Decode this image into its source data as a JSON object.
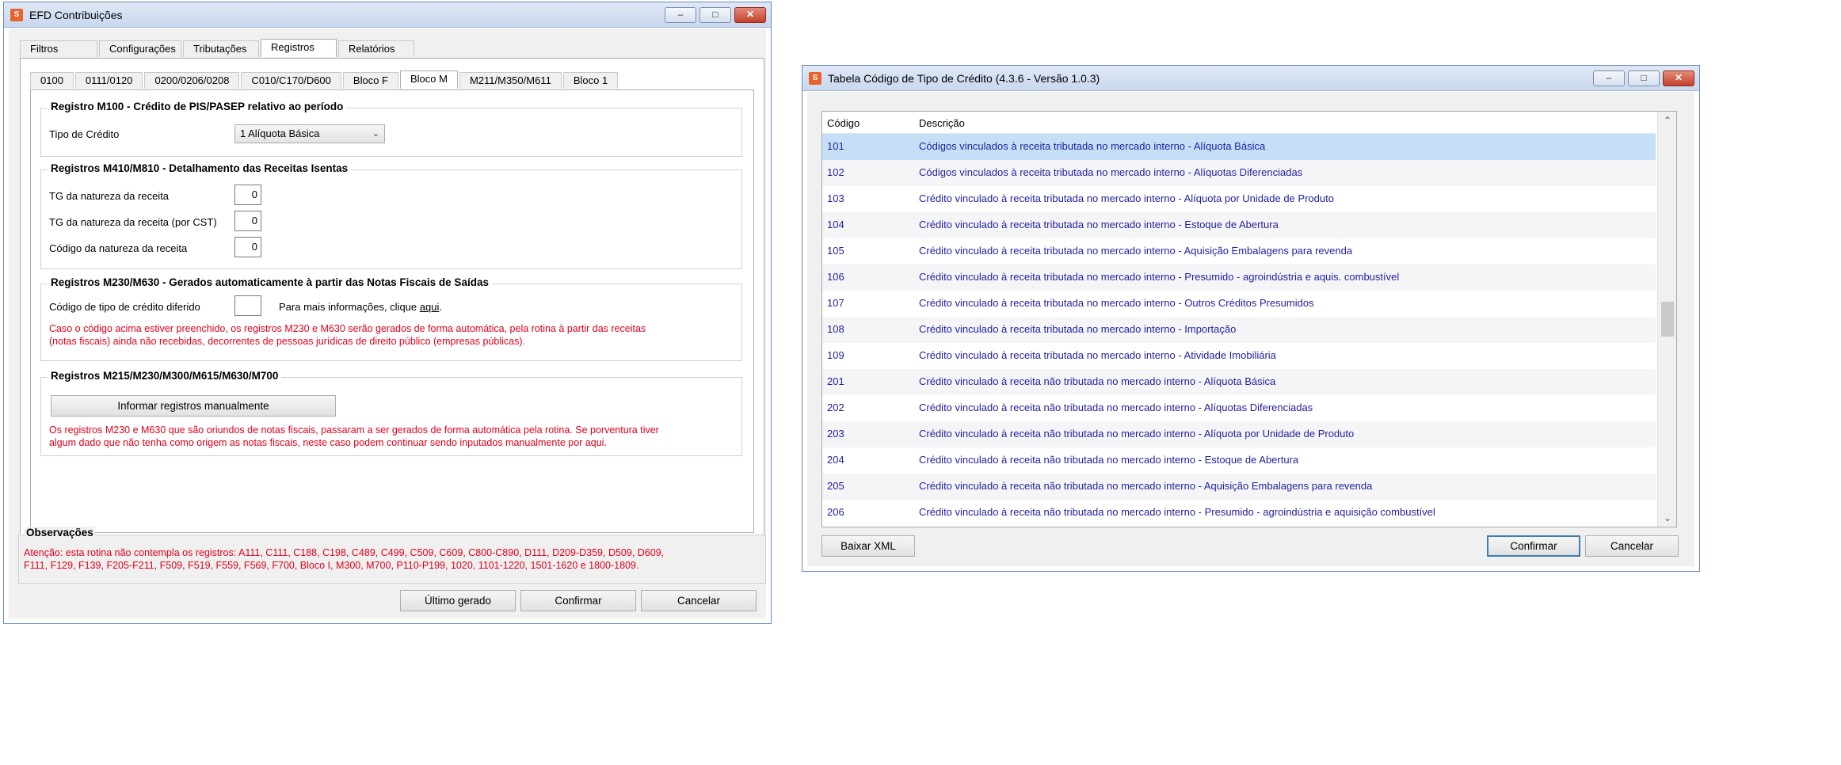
{
  "left_window": {
    "title": "EFD Contribuições",
    "top_tabs": [
      "Filtros",
      "Configurações",
      "Tributações",
      "Registros",
      "Relatórios"
    ],
    "sub_tabs": [
      "0100",
      "0111/0120",
      "0200/0206/0208",
      "C010/C170/D600",
      "Bloco F",
      "Bloco M",
      "M211/M350/M611",
      "Bloco 1"
    ],
    "m100": {
      "title": "Registro M100 - Crédito de PIS/PASEP relativo ao período",
      "tipo_label": "Tipo de Crédito",
      "tipo_value": "1 Alíquota Básica"
    },
    "m410": {
      "title": "Registros M410/M810 - Detalhamento das Receitas Isentas",
      "fields": [
        {
          "label": "TG da natureza da receita",
          "value": "0"
        },
        {
          "label": "TG da natureza da receita (por CST)",
          "value": "0"
        },
        {
          "label": "Código da natureza da receita",
          "value": "0"
        }
      ]
    },
    "m230": {
      "title": "Registros M230/M630 - Gerados automaticamente à partir das Notas Fiscais de Saídas",
      "codigo_label": "Código de tipo de crédito diferido",
      "info_prefix": "Para mais informações, clique ",
      "info_link": "aqui",
      "info_suffix": ".",
      "warning_line1": "Caso o código acima estiver preenchido, os registros M230 e M630 serão gerados de forma automática, pela rotina à partir das receitas",
      "warning_line2": "(notas fiscais) ainda não recebidas, decorrentes de pessoas jurídicas de direito público (empresas públicas)."
    },
    "m215": {
      "title": "Registros M215/M230/M300/M615/M630/M700",
      "button": "Informar registros manualmente",
      "warning_line1": "Os registros M230 e M630 que são oriundos de notas fiscais, passaram a ser gerados de forma automática pela rotina. Se porventura tiver",
      "warning_line2": "algum dado que não tenha como origem as notas fiscais, neste caso podem continuar sendo inputados manualmente por aqui."
    },
    "observacoes": {
      "title": "Observações",
      "line1": "Atenção: esta rotina não contempla os registros: A111, C111, C188, C198, C489, C499, C509, C609, C800-C890, D111, D209-D359, D509, D609,",
      "line2": "F111, F129, F139, F205-F211, F509, F519, F559, F569, F700, Bloco I, M300, M700, P110-P199, 1020, 1101-1220, 1501-1620 e 1800-1809."
    },
    "buttons": {
      "ultimo": "Último gerado",
      "confirmar": "Confirmar",
      "cancelar": "Cancelar"
    }
  },
  "right_window": {
    "title": "Tabela Código de Tipo de Crédito (4.3.6 - Versão 1.0.3)",
    "columns": [
      "Código",
      "Descrição"
    ],
    "rows": [
      {
        "code": "101",
        "desc": "Códigos vinculados à receita tributada no mercado interno - Alíquota Básica"
      },
      {
        "code": "102",
        "desc": "Códigos vinculados à receita tributada no mercado interno - Alíquotas Diferenciadas"
      },
      {
        "code": "103",
        "desc": "Crédito vinculado à receita tributada no mercado interno - Alíquota por Unidade de Produto"
      },
      {
        "code": "104",
        "desc": "Crédito vinculado à receita tributada no mercado interno - Estoque de Abertura"
      },
      {
        "code": "105",
        "desc": "Crédito vinculado à receita tributada no mercado interno - Aquisição Embalagens para revenda"
      },
      {
        "code": "106",
        "desc": "Crédito vinculado à receita tributada no mercado interno - Presumido - agroindústria e aquis. combustível"
      },
      {
        "code": "107",
        "desc": "Crédito vinculado à receita tributada no mercado interno - Outros Créditos Presumidos"
      },
      {
        "code": "108",
        "desc": "Crédito vinculado à receita tributada no mercado interno - Importação"
      },
      {
        "code": "109",
        "desc": "Crédito vinculado à receita tributada no mercado interno - Atividade Imobiliária"
      },
      {
        "code": "201",
        "desc": "Crédito vinculado à receita não tributada no mercado interno - Alíquota Básica"
      },
      {
        "code": "202",
        "desc": "Crédito vinculado à receita não tributada no mercado interno - Alíquotas Diferenciadas"
      },
      {
        "code": "203",
        "desc": "Crédito vinculado à receita não tributada no mercado interno - Alíquota por Unidade de Produto"
      },
      {
        "code": "204",
        "desc": "Crédito vinculado à receita não tributada no mercado interno - Estoque de Abertura"
      },
      {
        "code": "205",
        "desc": "Crédito vinculado à receita não tributada no mercado interno - Aquisição Embalagens para revenda"
      },
      {
        "code": "206",
        "desc": "Crédito vinculado à receita não tributada no mercado interno - Presumido - agroindústria e aquisição combustível"
      }
    ],
    "buttons": {
      "baixar": "Baixar XML",
      "confirmar": "Confirmar",
      "cancelar": "Cancelar"
    }
  },
  "colors": {
    "accent": "#3c7fb1",
    "warning": "#e0001a",
    "link_text": "#1f1fa0",
    "selection": "#c5dff7"
  }
}
